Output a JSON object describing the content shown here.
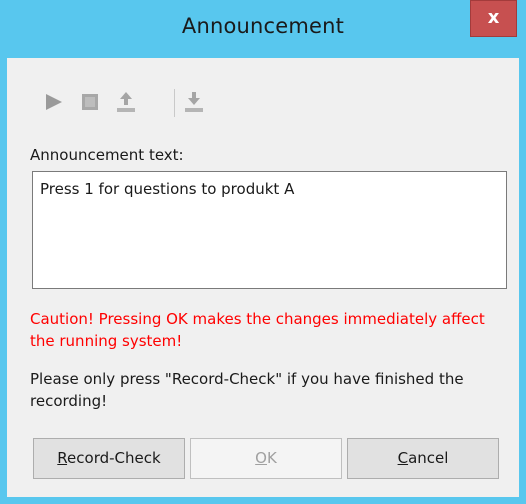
{
  "window": {
    "title": "Announcement",
    "close_glyph": "x"
  },
  "toolbar": {
    "buttons": [
      {
        "icon": "play-icon",
        "enabled": false
      },
      {
        "icon": "stop-icon",
        "enabled": false
      },
      {
        "icon": "upload-icon",
        "enabled": false
      },
      {
        "icon": "download-icon",
        "enabled": false
      }
    ]
  },
  "form": {
    "label": "Announcement text:",
    "text": "Press 1 for questions to produkt A"
  },
  "messages": {
    "caution": "Caution! Pressing OK makes the changes immediately affect the running system!",
    "note": "Please only press \"Record-Check\" if you have finished the recording!"
  },
  "buttons": {
    "record_check": {
      "mnemonic": "R",
      "rest": "ecord-Check"
    },
    "ok": {
      "mnemonic": "O",
      "rest": "K",
      "enabled": false
    },
    "cancel": {
      "mnemonic": "C",
      "rest": "ancel"
    }
  },
  "colors": {
    "titlebar": "#58c7ee",
    "close": "#c75050",
    "caution": "#ff0000"
  }
}
